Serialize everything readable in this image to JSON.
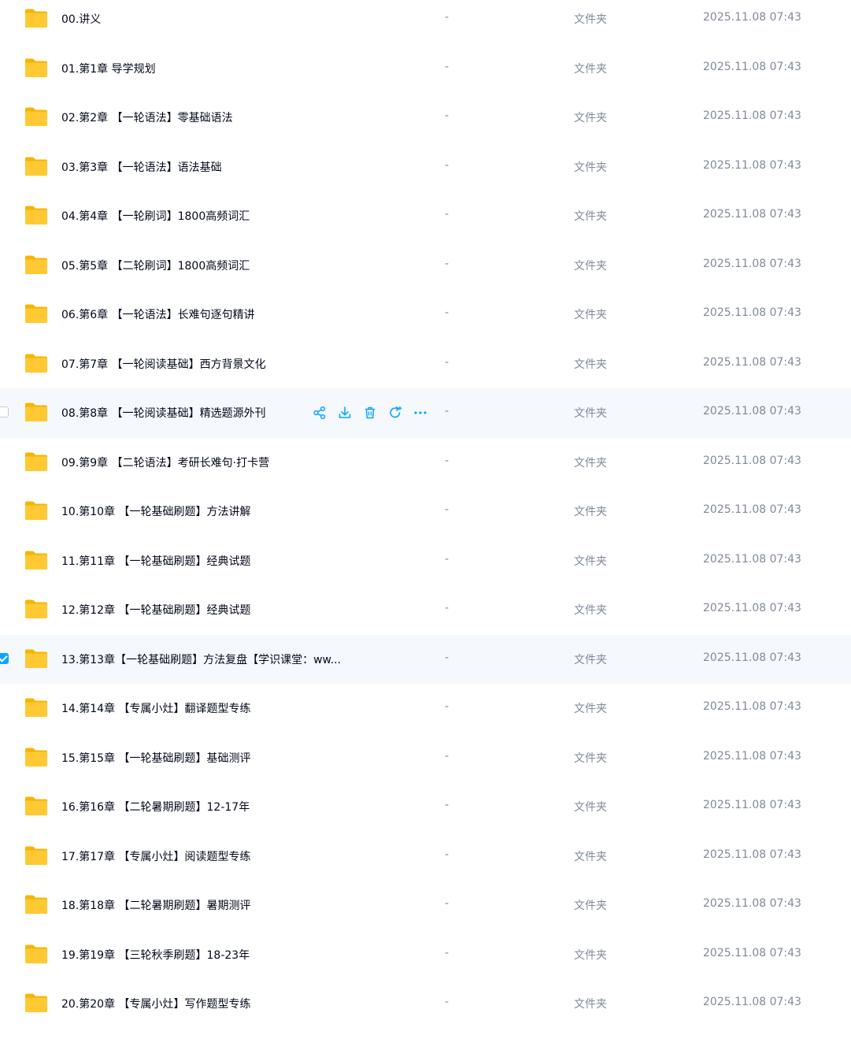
{
  "colors": {
    "accent": "#06a7ff",
    "folder": "#ffc933",
    "row_highlight": "#f5f8fc",
    "text": "#03081a",
    "muted": "#818999"
  },
  "files": [
    {
      "name": "00.讲义",
      "size": "-",
      "type": "文件夹",
      "date": "2025.11.08 07:43",
      "icon": "folder-icon",
      "state": ""
    },
    {
      "name": "01.第1章 导学规划",
      "size": "-",
      "type": "文件夹",
      "date": "2025.11.08 07:43",
      "icon": "folder-icon",
      "state": ""
    },
    {
      "name": "02.第2章 【一轮语法】零基础语法",
      "size": "-",
      "type": "文件夹",
      "date": "2025.11.08 07:43",
      "icon": "folder-icon",
      "state": ""
    },
    {
      "name": "03.第3章 【一轮语法】语法基础",
      "size": "-",
      "type": "文件夹",
      "date": "2025.11.08 07:43",
      "icon": "folder-icon",
      "state": ""
    },
    {
      "name": "04.第4章 【一轮刷词】1800高频词汇",
      "size": "-",
      "type": "文件夹",
      "date": "2025.11.08 07:43",
      "icon": "folder-icon",
      "state": ""
    },
    {
      "name": "05.第5章 【二轮刷词】1800高频词汇",
      "size": "-",
      "type": "文件夹",
      "date": "2025.11.08 07:43",
      "icon": "folder-icon",
      "state": ""
    },
    {
      "name": "06.第6章 【一轮语法】长难句逐句精讲",
      "size": "-",
      "type": "文件夹",
      "date": "2025.11.08 07:43",
      "icon": "folder-icon",
      "state": ""
    },
    {
      "name": "07.第7章 【一轮阅读基础】西方背景文化",
      "size": "-",
      "type": "文件夹",
      "date": "2025.11.08 07:43",
      "icon": "folder-icon",
      "state": ""
    },
    {
      "name": "08.第8章 【一轮阅读基础】精选题源外刊",
      "size": "-",
      "type": "文件夹",
      "date": "2025.11.08 07:43",
      "icon": "folder-icon",
      "state": "hovered"
    },
    {
      "name": "09.第9章 【二轮语法】考研长难句·打卡营",
      "size": "-",
      "type": "文件夹",
      "date": "2025.11.08 07:43",
      "icon": "folder-icon",
      "state": ""
    },
    {
      "name": "10.第10章 【一轮基础刷题】方法讲解",
      "size": "-",
      "type": "文件夹",
      "date": "2025.11.08 07:43",
      "icon": "folder-icon",
      "state": ""
    },
    {
      "name": "11.第11章 【一轮基础刷题】经典试题",
      "size": "-",
      "type": "文件夹",
      "date": "2025.11.08 07:43",
      "icon": "folder-icon",
      "state": ""
    },
    {
      "name": "12.第12章 【一轮基础刷题】经典试题",
      "size": "-",
      "type": "文件夹",
      "date": "2025.11.08 07:43",
      "icon": "folder-icon",
      "state": ""
    },
    {
      "name": "13.第13章【一轮基础刷题】方法复盘【学识课堂：ww...",
      "size": "-",
      "type": "文件夹",
      "date": "2025.11.08 07:43",
      "icon": "folder-icon",
      "state": "selected"
    },
    {
      "name": "14.第14章 【专属小灶】翻译题型专练",
      "size": "-",
      "type": "文件夹",
      "date": "2025.11.08 07:43",
      "icon": "folder-icon",
      "state": ""
    },
    {
      "name": "15.第15章 【一轮基础刷题】基础测评",
      "size": "-",
      "type": "文件夹",
      "date": "2025.11.08 07:43",
      "icon": "folder-icon",
      "state": ""
    },
    {
      "name": "16.第16章 【二轮暑期刷题】12-17年",
      "size": "-",
      "type": "文件夹",
      "date": "2025.11.08 07:43",
      "icon": "folder-icon",
      "state": ""
    },
    {
      "name": "17.第17章 【专属小灶】阅读题型专练",
      "size": "-",
      "type": "文件夹",
      "date": "2025.11.08 07:43",
      "icon": "folder-icon",
      "state": ""
    },
    {
      "name": "18.第18章 【二轮暑期刷题】暑期测评",
      "size": "-",
      "type": "文件夹",
      "date": "2025.11.08 07:43",
      "icon": "folder-icon",
      "state": ""
    },
    {
      "name": "19.第19章 【三轮秋季刷题】18-23年",
      "size": "-",
      "type": "文件夹",
      "date": "2025.11.08 07:43",
      "icon": "folder-icon",
      "state": ""
    },
    {
      "name": "20.第20章 【专属小灶】写作题型专练",
      "size": "-",
      "type": "文件夹",
      "date": "2025.11.08 07:43",
      "icon": "folder-icon",
      "state": ""
    }
  ],
  "row_actions": [
    {
      "icon": "share-icon"
    },
    {
      "icon": "download-icon"
    },
    {
      "icon": "delete-icon"
    },
    {
      "icon": "refresh-icon"
    },
    {
      "icon": "more-icon"
    }
  ]
}
